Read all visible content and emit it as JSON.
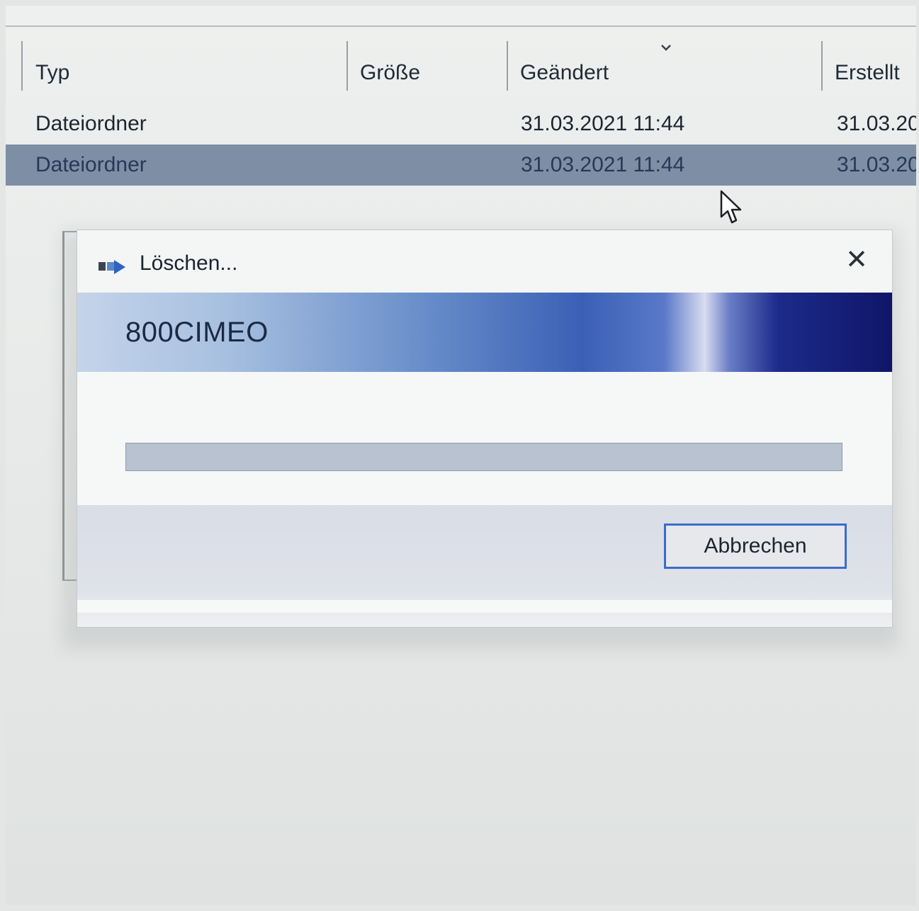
{
  "explorer": {
    "columns": {
      "type": "Typ",
      "size": "Größe",
      "modified": "Geändert",
      "created": "Erstellt"
    },
    "rows": [
      {
        "type": "Dateiordner",
        "size": "",
        "modified": "31.03.2021 11:44",
        "created": "31.03.20",
        "selected": false
      },
      {
        "type": "Dateiordner",
        "size": "",
        "modified": "31.03.2021 11:44",
        "created": "31.03.20",
        "selected": true
      }
    ]
  },
  "dialog": {
    "title": "Löschen...",
    "item_name": "800CIMEO",
    "progress": 0,
    "cancel_label": "Abbrechen",
    "close_glyph": "✕"
  },
  "icons": {
    "title_icon": "delete-move-icon",
    "close": "close-icon",
    "sort": "chevron-down-icon",
    "cursor": "mouse-pointer-icon"
  },
  "colors": {
    "selected_row": "#7e8ea5",
    "button_border": "#3b6dc7",
    "banner_dark": "#0f1668"
  }
}
